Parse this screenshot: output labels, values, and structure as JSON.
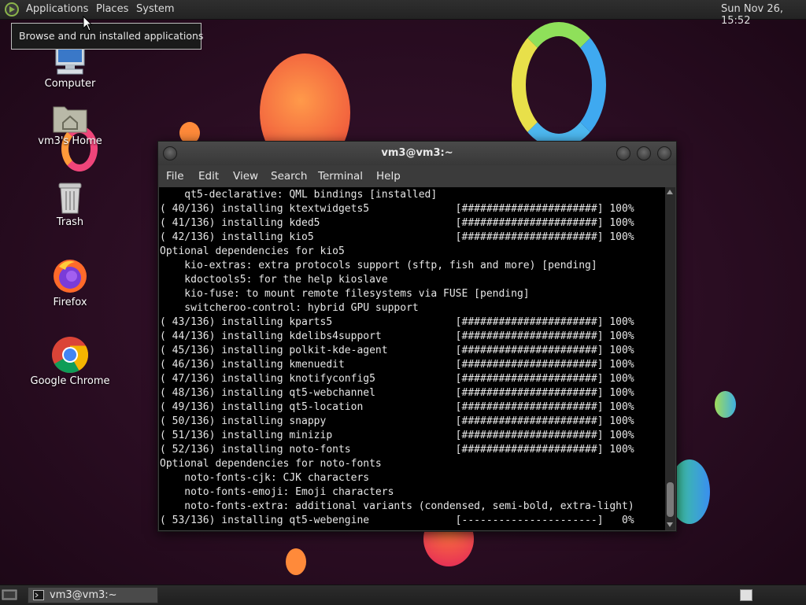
{
  "top_panel": {
    "menus": [
      "Applications",
      "Places",
      "System"
    ],
    "clock": "Sun Nov 26, 15:52"
  },
  "tooltip": "Browse and run installed applications",
  "desktop_icons": [
    {
      "label": "Computer",
      "icon": "computer-icon"
    },
    {
      "label": "vm3's Home",
      "icon": "home-folder-icon"
    },
    {
      "label": "Trash",
      "icon": "trash-icon"
    },
    {
      "label": "Firefox",
      "icon": "firefox-icon"
    },
    {
      "label": "Google Chrome",
      "icon": "chrome-icon"
    }
  ],
  "terminal": {
    "title": "vm3@vm3:~",
    "menu": [
      "File",
      "Edit",
      "View",
      "Search",
      "Terminal",
      "Help"
    ],
    "lines": [
      "    qt5-declarative: QML bindings [installed]",
      "( 40/136) installing ktextwidgets5              [######################] 100%",
      "( 41/136) installing kded5                      [######################] 100%",
      "( 42/136) installing kio5                       [######################] 100%",
      "Optional dependencies for kio5",
      "    kio-extras: extra protocols support (sftp, fish and more) [pending]",
      "    kdoctools5: for the help kioslave",
      "    kio-fuse: to mount remote filesystems via FUSE [pending]",
      "    switcheroo-control: hybrid GPU support",
      "( 43/136) installing kparts5                    [######################] 100%",
      "( 44/136) installing kdelibs4support            [######################] 100%",
      "( 45/136) installing polkit-kde-agent           [######################] 100%",
      "( 46/136) installing kmenuedit                  [######################] 100%",
      "( 47/136) installing knotifyconfig5             [######################] 100%",
      "( 48/136) installing qt5-webchannel             [######################] 100%",
      "( 49/136) installing qt5-location               [######################] 100%",
      "( 50/136) installing snappy                     [######################] 100%",
      "( 51/136) installing minizip                    [######################] 100%",
      "( 52/136) installing noto-fonts                 [######################] 100%",
      "Optional dependencies for noto-fonts",
      "    noto-fonts-cjk: CJK characters",
      "    noto-fonts-emoji: Emoji characters",
      "    noto-fonts-extra: additional variants (condensed, semi-bold, extra-light)",
      "( 53/136) installing qt5-webengine              [----------------------]   0%"
    ]
  },
  "taskbar": {
    "window_label": "vm3@vm3:~"
  },
  "colors": {
    "desktop_bg": "#2a0d22",
    "panel_bg": "#262626",
    "terminal_bg": "#000000",
    "terminal_fg": "#e6e6e6"
  }
}
